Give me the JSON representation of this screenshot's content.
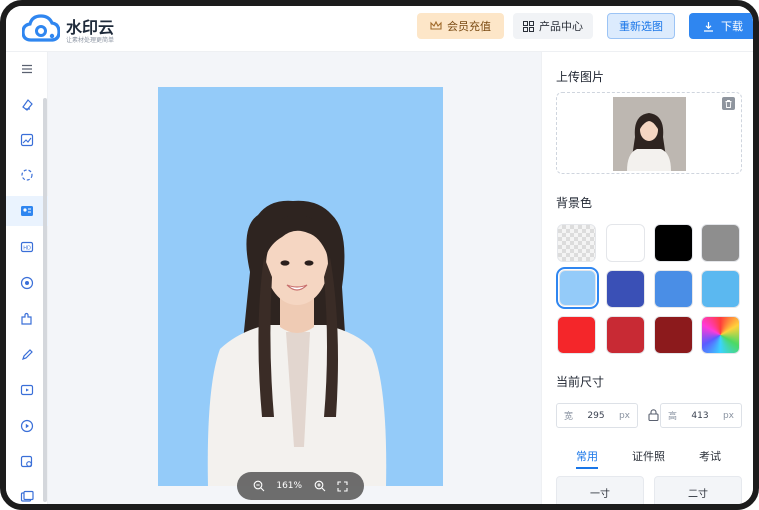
{
  "logo": {
    "name": "水印云",
    "slogan": "让素材处理更简单"
  },
  "header": {
    "vip_label": "会员充值",
    "products_label": "产品中心",
    "reselect_label": "重新选图",
    "download_label": "下载"
  },
  "sidebar": {
    "items": [
      {
        "icon": "menu-icon"
      },
      {
        "icon": "eraser-icon"
      },
      {
        "icon": "image-edit-icon"
      },
      {
        "icon": "cutout-icon"
      },
      {
        "icon": "id-photo-icon",
        "active": true
      },
      {
        "icon": "hd-icon"
      },
      {
        "icon": "circle-photo-icon"
      },
      {
        "icon": "puzzle-icon"
      },
      {
        "icon": "pen-icon"
      },
      {
        "icon": "video-edit-icon"
      },
      {
        "icon": "play-icon"
      },
      {
        "icon": "image-search-icon"
      },
      {
        "icon": "gallery-icon"
      }
    ]
  },
  "canvas": {
    "zoom": "161%"
  },
  "panel": {
    "upload_title": "上传图片",
    "bg_title": "背景色",
    "bg_colors": [
      "transparent",
      "#ffffff",
      "#000000",
      "#8e8e8e",
      "#94cbf9",
      "#3a50b6",
      "#4a8ee6",
      "#5bb8f0",
      "#f4262a",
      "#c82a34",
      "#8c1a1c",
      "rainbow"
    ],
    "selected_color": "#94cbf9",
    "size_title": "当前尺寸",
    "width_label": "宽",
    "width_value": "295",
    "width_unit": "px",
    "height_label": "高",
    "height_value": "413",
    "height_unit": "px",
    "tabs": [
      "常用",
      "证件照",
      "考试"
    ],
    "active_tab": "常用",
    "presets": [
      "一寸",
      "二寸"
    ]
  }
}
